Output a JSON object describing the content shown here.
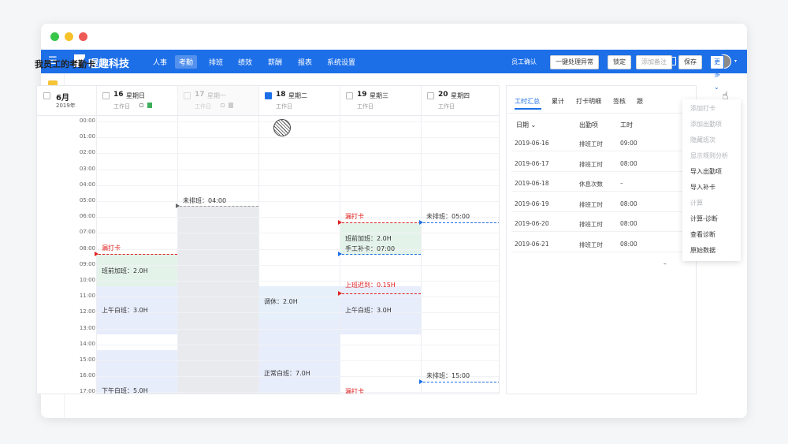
{
  "topbar": {
    "menu_glyph": "☰",
    "brand": "喔趣科技",
    "nav": [
      "人事",
      "考勤",
      "排班",
      "绩效",
      "薪酬",
      "报表",
      "系统设置"
    ],
    "active_nav": "考勤",
    "icons": [
      "document-icon",
      "bell-icon",
      "avatar"
    ],
    "caret": "▾"
  },
  "page": {
    "title": "我员工的考勤卡",
    "buttons": [
      "员工确认",
      "一键处理异常",
      "锁定",
      "添加备注",
      "保存",
      "更多"
    ],
    "more_caret": "⌄"
  },
  "sidebar": {
    "icons": [
      "attendance-card-icon",
      "contacts-icon",
      "phone-icon",
      "clipboard-icon",
      "pie-chart-icon",
      "calendar-icon",
      "id-card-icon",
      "list-icon",
      "document-edit-icon",
      "time-card-icon",
      "settings-icon"
    ],
    "active": "time-card-icon"
  },
  "calendar": {
    "month": "6月",
    "year": "2019年",
    "days": [
      {
        "num": "16",
        "name": "星期日",
        "sub": "工作日",
        "checked": false,
        "muted": false
      },
      {
        "num": "17",
        "name": "星期一",
        "sub": "工作日",
        "checked": false,
        "muted": true
      },
      {
        "num": "18",
        "name": "星期二",
        "sub": "工作日",
        "checked": true,
        "muted": false
      },
      {
        "num": "19",
        "name": "星期三",
        "sub": "工作日",
        "checked": false,
        "muted": false
      },
      {
        "num": "20",
        "name": "星期四",
        "sub": "工作日",
        "checked": false,
        "muted": false
      }
    ],
    "times": [
      "00:00",
      "01:00",
      "02:00",
      "03:00",
      "04:00",
      "05:00",
      "06:00",
      "07:00",
      "08:00",
      "09:00",
      "10:00",
      "11:00",
      "12:00",
      "13:00",
      "14:00",
      "15:00",
      "16:00",
      "17:00"
    ],
    "events": [
      {
        "text": "漏打卡",
        "color": "red"
      },
      {
        "text": "班前加班：2.0H"
      },
      {
        "text": "上午白班：3.0H"
      },
      {
        "text": "下午白班：5.0H"
      },
      {
        "text": "未排班：04:00"
      },
      {
        "text": "调休：2.0H"
      },
      {
        "text": "正常白班：7.0H"
      },
      {
        "text": "漏打卡",
        "color": "red"
      },
      {
        "text": "班前加班：2.0H"
      },
      {
        "text": "手工补卡：07:00"
      },
      {
        "text": "上班迟到：0.15H",
        "color": "red"
      },
      {
        "text": "上午白班：3.0H"
      },
      {
        "text": "漏打卡",
        "color": "red"
      },
      {
        "text": "未排班：05:00"
      },
      {
        "text": "未排班：15:00"
      }
    ],
    "colors": {
      "accent": "#1d6fe8",
      "red": "#e02020",
      "green_block": "#e4f3ea",
      "blue_block": "#e8edfb",
      "gray_block": "#e9eaed"
    }
  },
  "right_panel": {
    "tabs": [
      "工时汇总",
      "累计",
      "打卡明细",
      "签核",
      "跟"
    ],
    "headers": [
      "日期",
      "出勤项",
      "工时"
    ],
    "date_caret": "⌄",
    "rows": [
      {
        "date": "2019-06-16",
        "item": "排班工时",
        "time": "09:00"
      },
      {
        "date": "2019-06-17",
        "item": "排班工时",
        "time": "08:00"
      },
      {
        "date": "2019-06-18",
        "item": "休息次数",
        "time": "–"
      },
      {
        "date": "2019-06-19",
        "item": "排班工时",
        "time": "08:00"
      },
      {
        "date": "2019-06-20",
        "item": "排班工时",
        "time": "08:00"
      },
      {
        "date": "2019-06-21",
        "item": "排班工时",
        "time": "08:00"
      }
    ],
    "extra": "–"
  },
  "dropdown": {
    "items": [
      "添加打卡",
      "添加出勤项",
      "隐藏班次",
      "显示规则分析",
      "导入出勤项",
      "导入补卡",
      "计算",
      "计算-诊断",
      "查看诊断",
      "原始数据"
    ],
    "disabled": [
      true,
      true,
      true,
      true,
      false,
      false,
      true,
      false,
      false,
      false
    ]
  }
}
